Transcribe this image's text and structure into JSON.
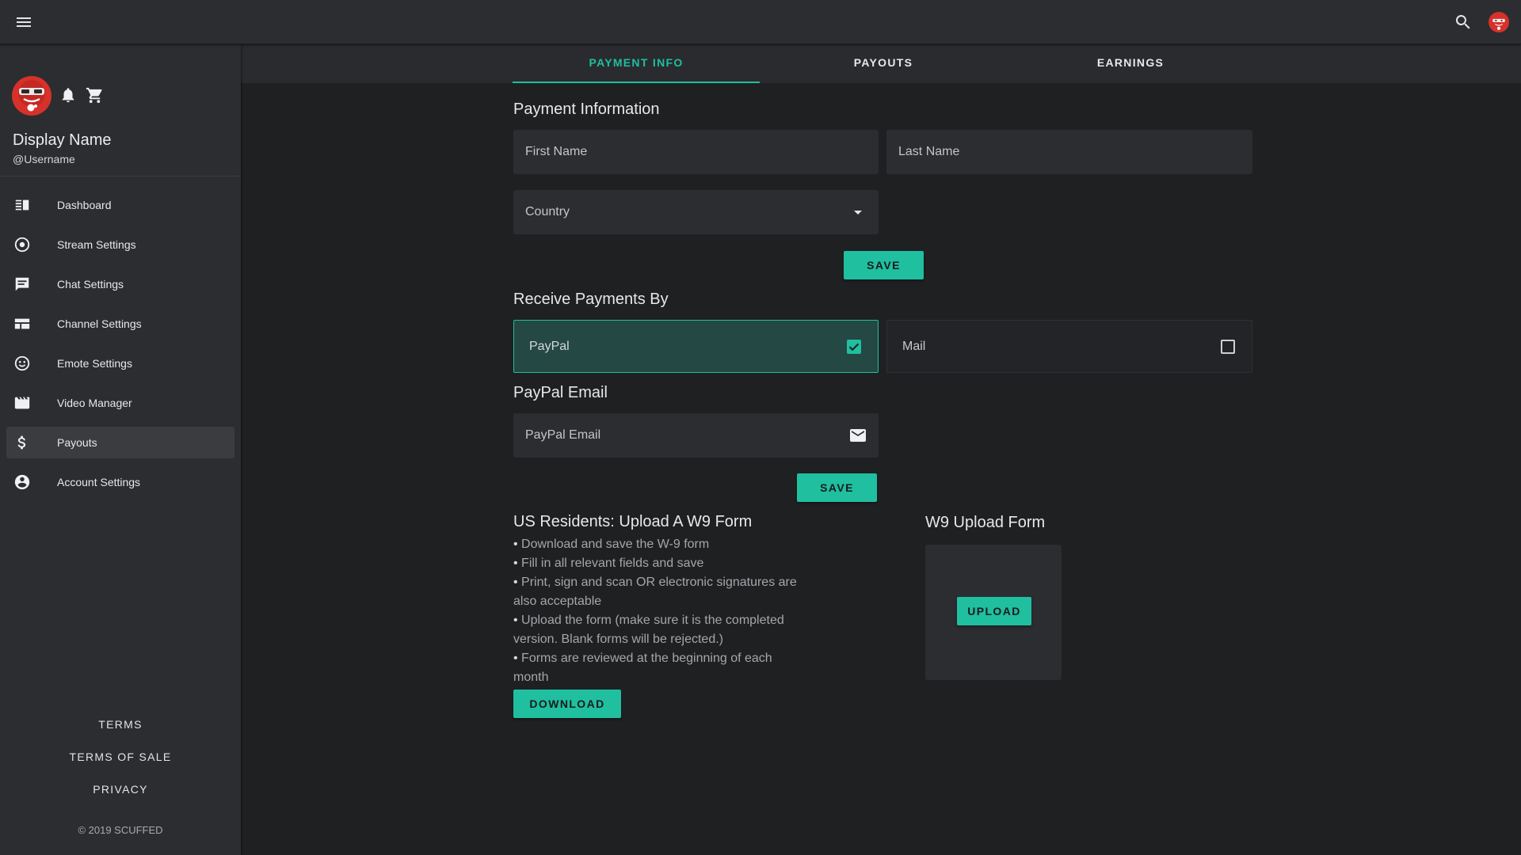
{
  "sidebar": {
    "display_name": "Display Name",
    "username": "@Username",
    "nav": [
      {
        "label": "Dashboard",
        "icon": "dashboard-icon"
      },
      {
        "label": "Stream Settings",
        "icon": "stream-icon"
      },
      {
        "label": "Chat Settings",
        "icon": "chat-icon"
      },
      {
        "label": "Channel Settings",
        "icon": "channel-icon"
      },
      {
        "label": "Emote Settings",
        "icon": "emote-icon"
      },
      {
        "label": "Video Manager",
        "icon": "video-icon"
      },
      {
        "label": "Payouts",
        "icon": "dollar-icon",
        "active": true
      },
      {
        "label": "Account Settings",
        "icon": "account-icon"
      }
    ],
    "footer_links": [
      "TERMS",
      "TERMS OF SALE",
      "PRIVACY"
    ],
    "copyright": "© 2019 SCUFFED"
  },
  "tabs": [
    {
      "label": "PAYMENT INFO",
      "active": true
    },
    {
      "label": "PAYOUTS"
    },
    {
      "label": "EARNINGS"
    }
  ],
  "payment_info": {
    "title": "Payment Information",
    "first_name_placeholder": "First Name",
    "last_name_placeholder": "Last Name",
    "country_placeholder": "Country",
    "save_label": "SAVE"
  },
  "receive": {
    "title": "Receive Payments By",
    "options": [
      {
        "label": "PayPal",
        "checked": true
      },
      {
        "label": "Mail",
        "checked": false
      }
    ]
  },
  "paypal": {
    "title": "PayPal Email",
    "email_placeholder": "PayPal Email",
    "save_label": "SAVE"
  },
  "w9": {
    "title": "US Residents: Upload A W9 Form",
    "bullets": [
      "Download and save the W-9 form",
      "Fill in all relevant fields and save",
      "Print, sign and scan OR electronic signatures are also acceptable",
      "Upload the form (make sure it is the completed version. Blank forms will be rejected.)",
      "Forms are reviewed at the beginning of each month"
    ],
    "download_label": "DOWNLOAD",
    "upload_title": "W9 Upload Form",
    "upload_label": "UPLOAD"
  },
  "colors": {
    "accent": "#1fbfa0",
    "background": "#1f2022",
    "panel": "#2c2d30",
    "avatar_red": "#d6312b"
  }
}
